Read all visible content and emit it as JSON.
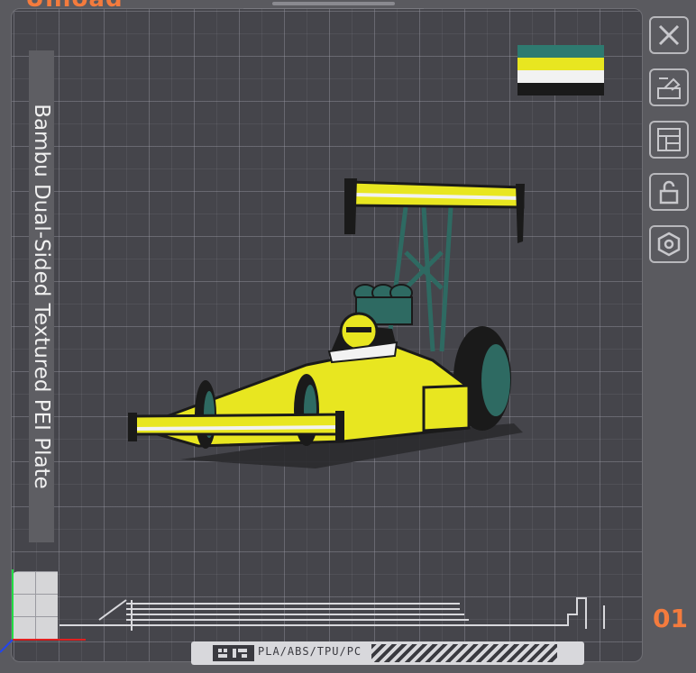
{
  "header": {
    "title": "Unload"
  },
  "plate": {
    "label": "Bambu Dual-Sided Textured PEI Plate",
    "number": "01",
    "filament_types": "PLA/ABS/TPU/PC"
  },
  "colors": {
    "accent": "#f47b3d",
    "plate_bg": "#45454b",
    "model_yellow": "#e8e620",
    "model_teal": "#2e6a62",
    "model_black": "#1a1a1a",
    "model_white": "#f2f2f2"
  },
  "filament_swatches": [
    "#2e7a70",
    "#e8e620",
    "#f2f2f2",
    "#1a1a1a"
  ],
  "toolbar": {
    "buttons": [
      {
        "name": "close",
        "icon": "close-icon"
      },
      {
        "name": "auto-orient",
        "icon": "auto-orient-icon"
      },
      {
        "name": "arrange",
        "icon": "arrange-icon"
      },
      {
        "name": "lock",
        "icon": "lock-icon"
      },
      {
        "name": "plate-settings",
        "icon": "hexagon-settings-icon"
      }
    ]
  },
  "model": {
    "name": "dragster-car",
    "icon": "dragster-model"
  }
}
